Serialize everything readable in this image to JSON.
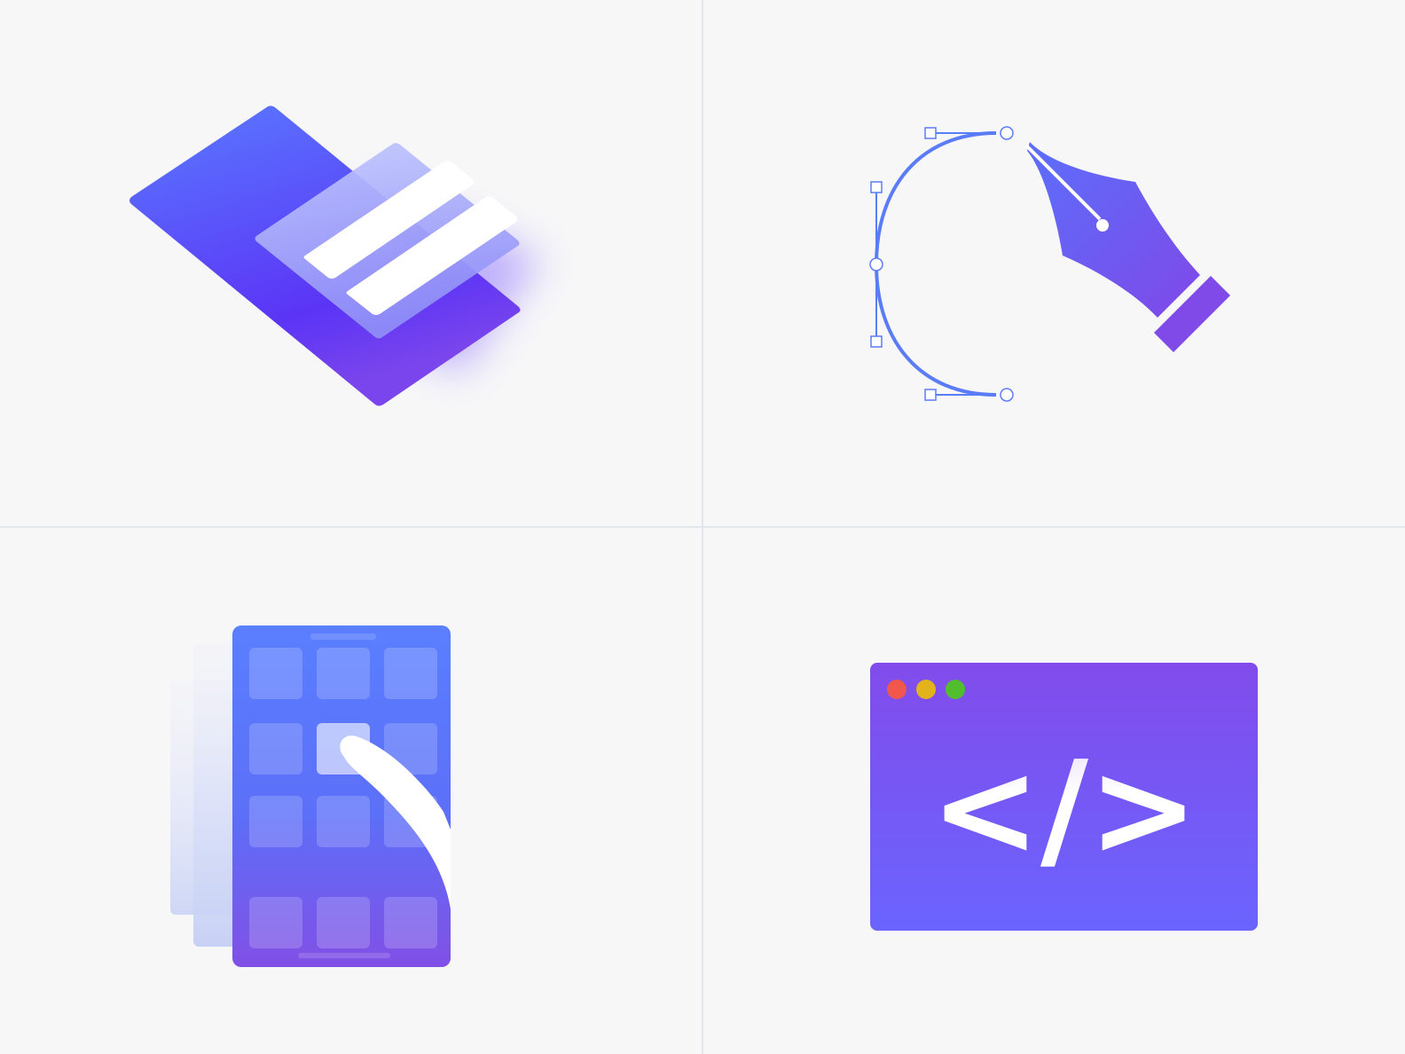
{
  "illustrations": [
    {
      "name": "stacked-document",
      "icon": "document-stack-icon"
    },
    {
      "name": "vector-pen-tool",
      "icon": "pen-tool-icon"
    },
    {
      "name": "mobile-app-page-curl",
      "icon": "phone-app-grid-icon"
    },
    {
      "name": "code-browser-window",
      "icon": "code-window-icon"
    }
  ],
  "code_window": {
    "symbol": "</>",
    "traffic_lights": [
      "#f2574d",
      "#e3b31c",
      "#52bd2f"
    ]
  },
  "colors": {
    "background": "#f7f7f8",
    "divider": "#e4e6ee",
    "accent_blue": "#5b82ff",
    "accent_purple": "#7b47ee"
  }
}
